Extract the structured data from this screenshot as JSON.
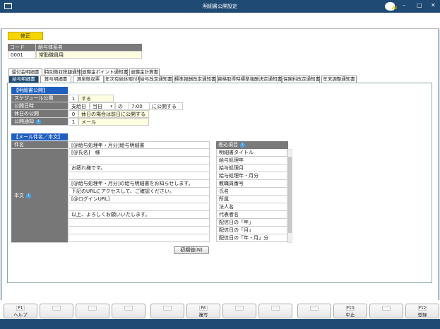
{
  "window": {
    "title": "明細書公開設定",
    "logo": "AI"
  },
  "mode_label": "修正",
  "code_table": {
    "headers": [
      "コード",
      "給与体系名"
    ],
    "code": "0001",
    "name": "常勤職員用"
  },
  "tabs_row1": [
    "還付金明細書",
    "特別徴収税額通知書",
    "退職金ポイント通知書",
    "退職金計算書"
  ],
  "tabs_row2": [
    "給与明細書",
    "賞与明細書",
    "源泉徴収票",
    "年次有給休暇付与通知書",
    "給与改定通知書",
    "標準報酬改定通知書",
    "資格取得時標準報酬決定通知書",
    "保険料改定通知書",
    "年末調整通知書"
  ],
  "active_tab": "給与明細書",
  "publish": {
    "section_title": "【明細書公開】",
    "schedule": {
      "label": "スケジュール公開",
      "code": "1",
      "value": "する"
    },
    "datetime": {
      "label": "公開日時",
      "base": "支給日",
      "day": "当日",
      "of": "の",
      "time": "7:00",
      "suffix": "に公開する"
    },
    "holiday": {
      "label": "休日の公開",
      "code": "0",
      "value": "休日の場合は前日に公開する"
    },
    "notify": {
      "label": "公開通知",
      "code": "1",
      "value": "メール"
    }
  },
  "mail": {
    "section_title": "【メール件名／本文】",
    "subject_label": "件名",
    "subject": "[@給与処理年・月分]給与明細書",
    "body_label": "本文",
    "body_lines": [
      "[@氏名]　様",
      "",
      "お疲れ様です。",
      "",
      "[@給与処理年・月分]の給与明細書をお知らせします。",
      "下記のURLにアクセスして、ご確認ください。",
      "[@ログインURL]",
      "",
      "以上、よろしくお願いいたします。",
      "",
      "",
      ""
    ],
    "insert_header": "差込項目",
    "insert_items": [
      "明細書タイトル",
      "給与処理年",
      "給与処理月",
      "給与処理年・月分",
      "教職員番号",
      "氏名",
      "所属",
      "法人名",
      "代表者名",
      "配信日の「年」",
      "配信日の「月」",
      "配信日の「年・月」分"
    ],
    "reset_button": "初期値(N)"
  },
  "function_keys": [
    {
      "key": "F1",
      "label": "ヘルプ"
    },
    {
      "key": "",
      "label": ""
    },
    {
      "key": "",
      "label": ""
    },
    {
      "key": "",
      "label": ""
    },
    {
      "key": "",
      "label": ""
    },
    {
      "key": "F6",
      "label": "複写"
    },
    {
      "key": "",
      "label": ""
    },
    {
      "key": "",
      "label": ""
    },
    {
      "key": "",
      "label": ""
    },
    {
      "key": "F10",
      "label": "中止"
    },
    {
      "key": "",
      "label": ""
    },
    {
      "key": "F12",
      "label": "登録"
    }
  ]
}
